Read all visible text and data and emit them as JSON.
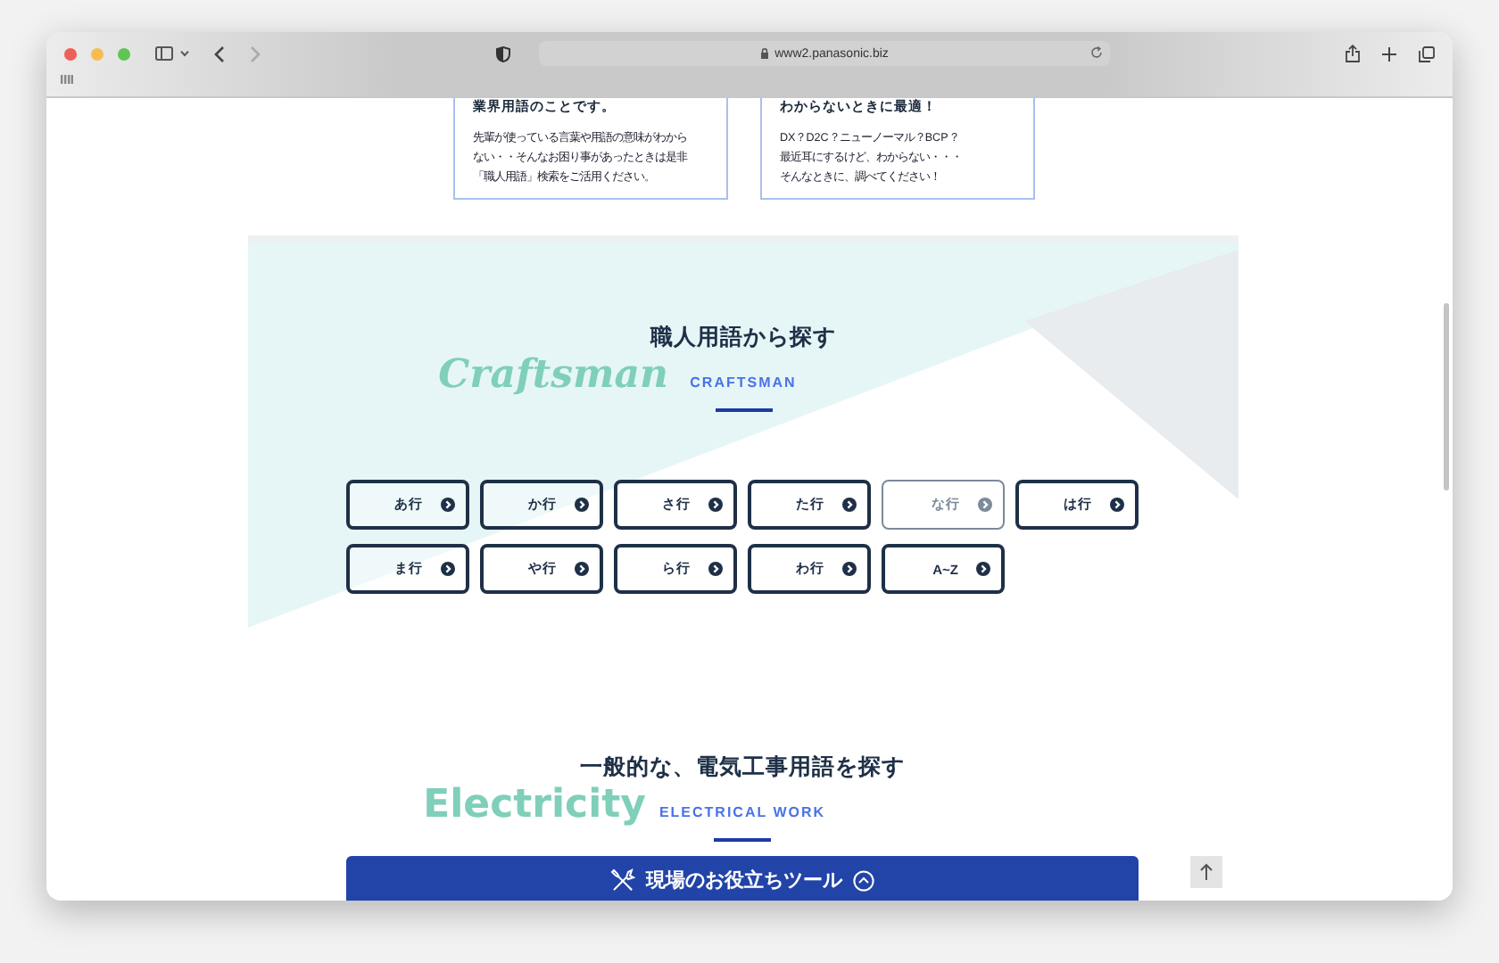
{
  "browser": {
    "url": "www2.panasonic.biz"
  },
  "intro_cards": [
    {
      "heading": "業界用語のことです。",
      "lines": [
        "先輩が使っている言葉や用語の意味がわから",
        "ない・・そんなお困り事があったときは是非",
        "「職人用語」検索をご活用ください。"
      ]
    },
    {
      "heading": "わからないときに最適！",
      "lines": [
        "DX？D2C？ニューノーマル？BCP？",
        "最近耳にするけど、わからない・・・",
        "そんなときに、調べてください！"
      ]
    }
  ],
  "craftsman": {
    "watermark": "Craftsman",
    "title": "職人用語から探す",
    "subtitle": "CRAFTSMAN",
    "buttons": [
      {
        "label": "あ行",
        "disabled": false
      },
      {
        "label": "か行",
        "disabled": false
      },
      {
        "label": "さ行",
        "disabled": false
      },
      {
        "label": "た行",
        "disabled": false
      },
      {
        "label": "な行",
        "disabled": true
      },
      {
        "label": "は行",
        "disabled": false
      },
      {
        "label": "ま行",
        "disabled": false
      },
      {
        "label": "や行",
        "disabled": false
      },
      {
        "label": "ら行",
        "disabled": false
      },
      {
        "label": "わ行",
        "disabled": false
      },
      {
        "label": "A~Z",
        "disabled": false
      }
    ]
  },
  "electrical": {
    "watermark": "Electricity",
    "title": "一般的な、電気工事用語を探す",
    "subtitle": "ELECTRICAL WORK"
  },
  "tool_bar": {
    "label": "現場のお役立ちツール"
  }
}
